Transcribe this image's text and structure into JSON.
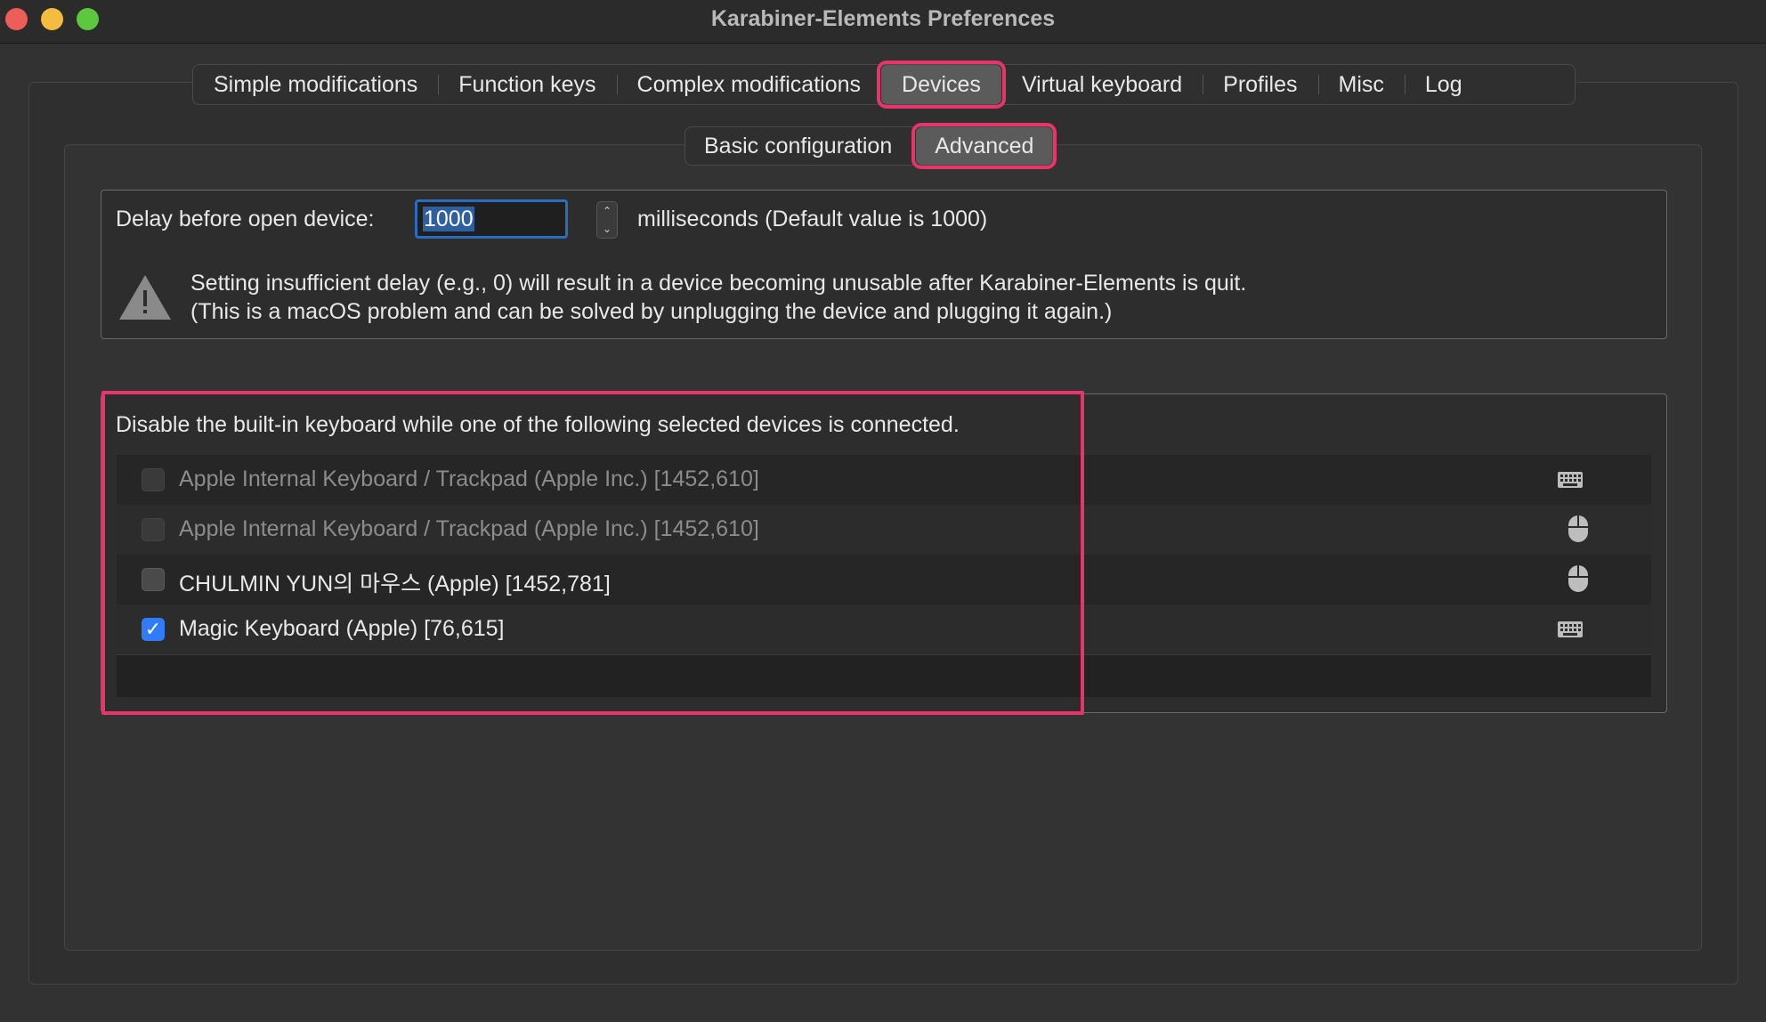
{
  "window": {
    "title": "Karabiner-Elements Preferences"
  },
  "tabs": [
    {
      "label": "Simple modifications",
      "active": false
    },
    {
      "label": "Function keys",
      "active": false
    },
    {
      "label": "Complex modifications",
      "active": false
    },
    {
      "label": "Devices",
      "active": true
    },
    {
      "label": "Virtual keyboard",
      "active": false
    },
    {
      "label": "Profiles",
      "active": false
    },
    {
      "label": "Misc",
      "active": false
    },
    {
      "label": "Log",
      "active": false
    }
  ],
  "subtabs": [
    {
      "label": "Basic configuration",
      "active": false
    },
    {
      "label": "Advanced",
      "active": true
    }
  ],
  "delay": {
    "label": "Delay before open device:",
    "value": "1000",
    "unit_text": "milliseconds (Default value is 1000)",
    "warning_line1": "Setting insufficient delay (e.g., 0) will result in a device becoming unusable after Karabiner-Elements is quit.",
    "warning_line2": "(This is a macOS problem and can be solved by unplugging the device and plugging it again.)"
  },
  "devices": {
    "title": "Disable the built-in keyboard while one of the following selected devices is connected.",
    "items": [
      {
        "name": "Apple Internal Keyboard / Trackpad (Apple Inc.) [1452,610]",
        "checked": false,
        "disabled": true,
        "icon": "keyboard-icon"
      },
      {
        "name": "Apple Internal Keyboard / Trackpad (Apple Inc.) [1452,610]",
        "checked": false,
        "disabled": true,
        "icon": "mouse-icon"
      },
      {
        "name": "CHULMIN YUN의 마우스 (Apple) [1452,781]",
        "checked": false,
        "disabled": false,
        "icon": "mouse-icon"
      },
      {
        "name": "Magic Keyboard (Apple) [76,615]",
        "checked": true,
        "disabled": false,
        "icon": "keyboard-icon"
      }
    ]
  },
  "colors": {
    "highlight": "#e8346a",
    "accent": "#2f7cf6"
  }
}
